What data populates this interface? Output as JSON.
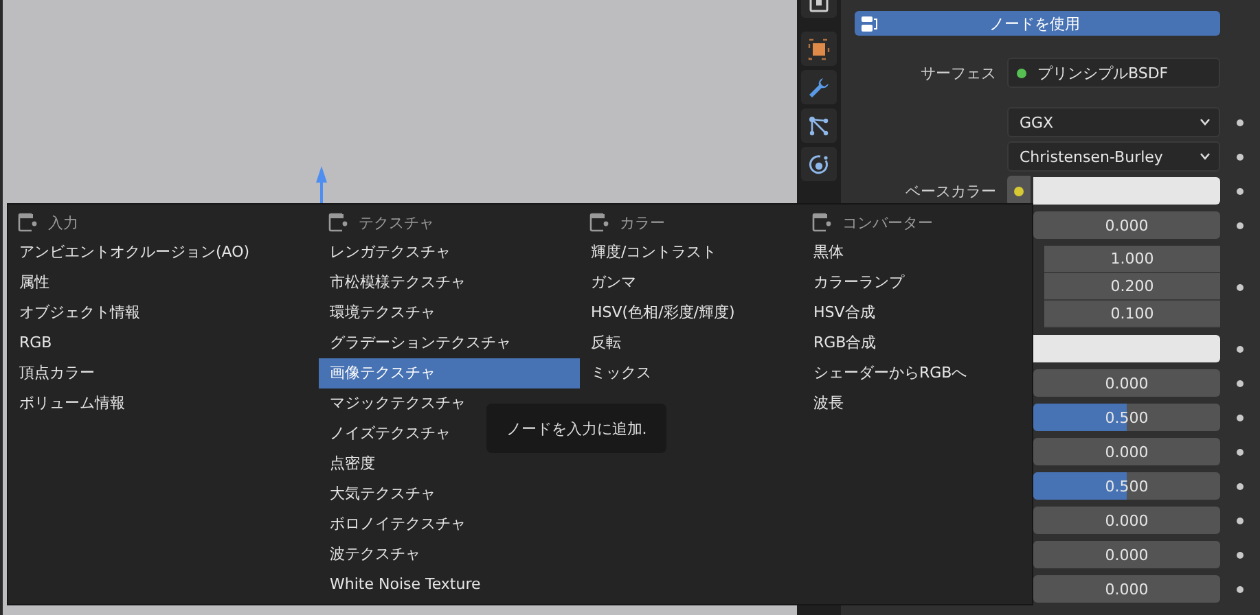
{
  "properties": {
    "tabs": [
      {
        "kind": "render",
        "selected": false
      },
      {
        "kind": "object",
        "selected": false
      },
      {
        "kind": "modifier",
        "selected": false
      },
      {
        "kind": "particles",
        "selected": false
      },
      {
        "kind": "physics",
        "selected": false
      }
    ],
    "use_nodes_button": {
      "label": "ノードを使用"
    },
    "rows": [
      {
        "kind": "shader",
        "label": "サーフェス",
        "value": "プリンシプルBSDF",
        "color": "#56c152"
      },
      {
        "kind": "spacer"
      },
      {
        "kind": "dropdown",
        "value": "GGX"
      },
      {
        "kind": "dropdown",
        "value": "Christensen-Burley"
      },
      {
        "kind": "color",
        "label": "ベースカラー",
        "color": "#d6c934"
      },
      {
        "kind": "slider",
        "value": "0.000",
        "level": 0
      },
      {
        "kind": "vector",
        "values": [
          "1.000",
          "0.200",
          "0.100"
        ]
      },
      {
        "kind": "swatch"
      },
      {
        "kind": "slider",
        "value": "0.000",
        "level": 0
      },
      {
        "kind": "slider",
        "value": "0.500",
        "level": 0.5
      },
      {
        "kind": "slider",
        "value": "0.000",
        "level": 0
      },
      {
        "kind": "slider",
        "value": "0.500",
        "level": 0.5
      },
      {
        "kind": "slider",
        "value": "0.000",
        "level": 0
      },
      {
        "kind": "slider",
        "value": "0.000",
        "level": 0
      },
      {
        "kind": "slider",
        "value": "0.000",
        "level": 0
      }
    ]
  },
  "add_menu": {
    "columns": [
      {
        "title": "入力",
        "items": [
          {
            "label": "アンビエントオクルージョン(AO)",
            "selected": false
          },
          {
            "label": "属性",
            "selected": false
          },
          {
            "label": "オブジェクト情報",
            "selected": false
          },
          {
            "label": "RGB",
            "selected": false
          },
          {
            "label": "頂点カラー",
            "selected": false
          },
          {
            "label": "ボリューム情報",
            "selected": false
          }
        ]
      },
      {
        "title": "テクスチャ",
        "items": [
          {
            "label": "レンガテクスチャ",
            "selected": false
          },
          {
            "label": "市松模様テクスチャ",
            "selected": false
          },
          {
            "label": "環境テクスチャ",
            "selected": false
          },
          {
            "label": "グラデーションテクスチャ",
            "selected": false
          },
          {
            "label": "画像テクスチャ",
            "selected": true
          },
          {
            "label": "マジックテクスチャ",
            "selected": false
          },
          {
            "label": "ノイズテクスチャ",
            "selected": false
          },
          {
            "label": "点密度",
            "selected": false
          },
          {
            "label": "大気テクスチャ",
            "selected": false
          },
          {
            "label": "ボロノイテクスチャ",
            "selected": false
          },
          {
            "label": "波テクスチャ",
            "selected": false
          },
          {
            "label": "White Noise Texture",
            "selected": false
          }
        ]
      },
      {
        "title": "カラー",
        "items": [
          {
            "label": "輝度/コントラスト",
            "selected": false
          },
          {
            "label": "ガンマ",
            "selected": false
          },
          {
            "label": "HSV(色相/彩度/輝度)",
            "selected": false
          },
          {
            "label": "反転",
            "selected": false
          },
          {
            "label": "ミックス",
            "selected": false
          }
        ]
      },
      {
        "title": "コンバーター",
        "items": [
          {
            "label": "黒体",
            "selected": false
          },
          {
            "label": "カラーランプ",
            "selected": false
          },
          {
            "label": "HSV合成",
            "selected": false
          },
          {
            "label": "RGB合成",
            "selected": false
          },
          {
            "label": "シェーダーからRGBへ",
            "selected": false
          },
          {
            "label": "波長",
            "selected": false
          }
        ]
      }
    ]
  },
  "tooltip": {
    "text": "ノードを入力に追加."
  }
}
